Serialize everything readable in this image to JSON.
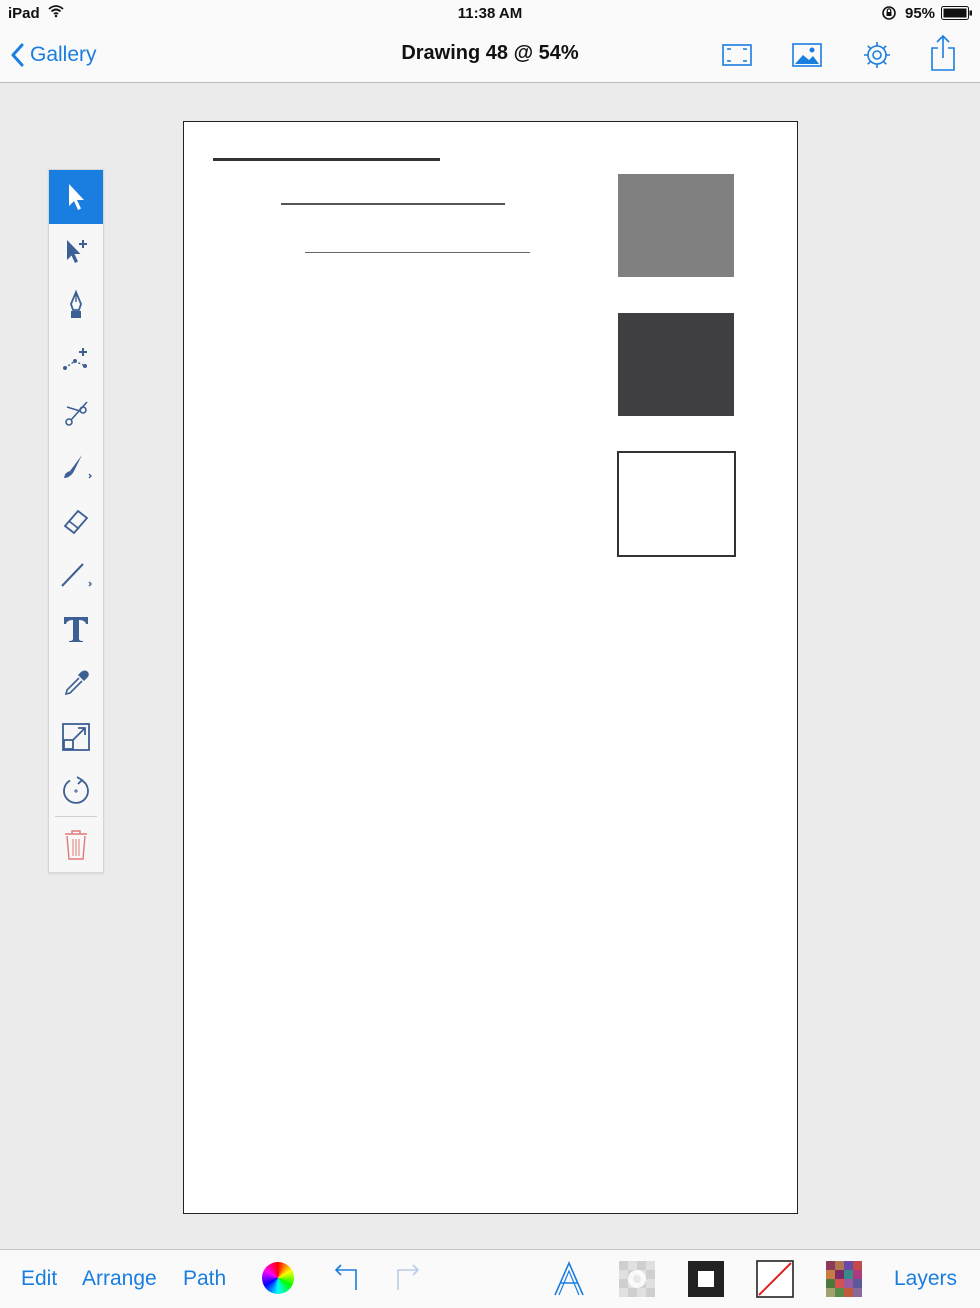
{
  "status_bar": {
    "device": "iPad",
    "time": "11:38 AM",
    "battery": "95%"
  },
  "nav": {
    "back_label": "Gallery",
    "title": "Drawing 48 @ 54%",
    "icons": [
      "fullscreen-icon",
      "image-icon",
      "gear-icon",
      "share-icon"
    ]
  },
  "toolbar": {
    "tools": [
      "select",
      "direct-select",
      "pen",
      "node-add",
      "scissors",
      "brush",
      "eraser",
      "line",
      "text",
      "eyedropper",
      "scale",
      "rotate",
      "trash"
    ],
    "active": "select"
  },
  "canvas": {
    "rect_colors": [
      "#808080",
      "#3f3f41",
      "#ffffff"
    ]
  },
  "bottom_bar": {
    "edit_label": "Edit",
    "arrange_label": "Arrange",
    "path_label": "Path",
    "layers_label": "Layers",
    "icons": [
      "color-wheel-icon",
      "undo-icon",
      "redo-icon",
      "font-icon",
      "shadow-icon",
      "stroke-icon",
      "fill-none-icon",
      "palette-icon"
    ]
  },
  "colors": {
    "accent": "#1a7ee0",
    "trash": "#e27a7a"
  }
}
